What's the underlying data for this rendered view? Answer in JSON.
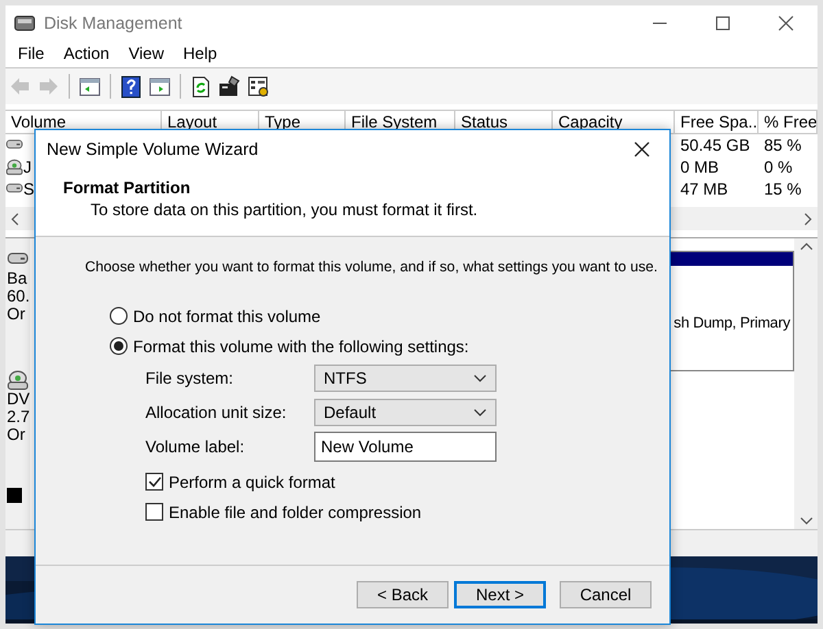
{
  "window": {
    "title": "Disk Management"
  },
  "menu": [
    "File",
    "Action",
    "View",
    "Help"
  ],
  "toolbar": [
    {
      "kind": "back",
      "disabled": true
    },
    {
      "kind": "forward",
      "disabled": true
    },
    {
      "kind": "tree",
      "disabled": false
    },
    {
      "kind": "help",
      "disabled": false
    },
    {
      "kind": "pane",
      "disabled": false
    },
    {
      "kind": "refresh",
      "disabled": false
    },
    {
      "kind": "properties",
      "disabled": false
    },
    {
      "kind": "settings",
      "disabled": false
    }
  ],
  "table": {
    "columns": [
      "Volume",
      "Layout",
      "Type",
      "File System",
      "Status",
      "Capacity",
      "Free Spa...",
      "% Free"
    ],
    "rows": [
      {
        "kind": "disk",
        "volume": "",
        "free_space": "50.45 GB",
        "percent_free": "85 %"
      },
      {
        "kind": "optical",
        "volume": "J",
        "free_space": "0 MB",
        "percent_free": "0 %"
      },
      {
        "kind": "disk",
        "volume": "S",
        "free_space": "47 MB",
        "percent_free": "15 %"
      }
    ]
  },
  "disks": [
    {
      "kind": "disk",
      "lines": [
        "Ba",
        "60.",
        "Or"
      ],
      "partition_text": "sh Dump, Primary"
    },
    {
      "kind": "optical",
      "lines": [
        "DV",
        "2.7",
        "Or"
      ]
    }
  ],
  "dialog": {
    "title": "New Simple Volume Wizard",
    "heading": "Format Partition",
    "subtitle": "To store data on this partition, you must format it first.",
    "intro": "Choose whether you want to format this volume, and if so, what settings you want to use.",
    "options": [
      {
        "label": "Do not format this volume",
        "selected": false
      },
      {
        "label": "Format this volume with the following settings:",
        "selected": true
      }
    ],
    "fields": [
      {
        "kind": "dropdown",
        "label": "File system:",
        "value": "NTFS"
      },
      {
        "kind": "dropdown",
        "label": "Allocation unit size:",
        "value": "Default"
      },
      {
        "kind": "text",
        "label": "Volume label:",
        "value": "New Volume"
      }
    ],
    "checkboxes": [
      {
        "label": "Perform a quick format",
        "checked": true
      },
      {
        "label": "Enable file and folder compression",
        "checked": false
      }
    ],
    "buttons": [
      {
        "label": "< Back",
        "default": false
      },
      {
        "label": "Next >",
        "default": true
      },
      {
        "label": "Cancel",
        "default": false
      }
    ]
  }
}
